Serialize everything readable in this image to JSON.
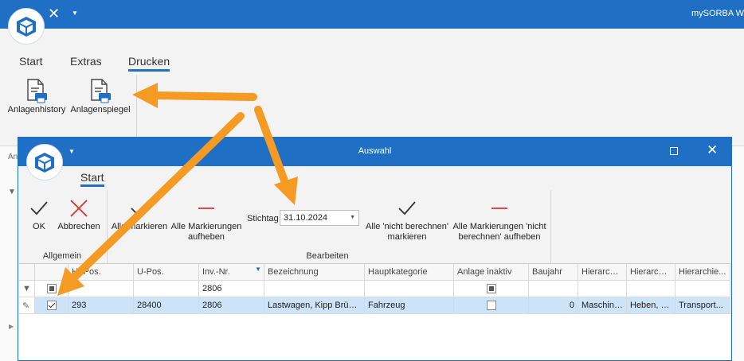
{
  "main": {
    "app_title": "mySORBA Wo",
    "tabs": [
      {
        "label": "Start"
      },
      {
        "label": "Extras"
      },
      {
        "label": "Drucken"
      }
    ],
    "buttons": [
      {
        "label": "Anlagenhistory"
      },
      {
        "label": "Anlagenspiegel"
      }
    ],
    "left_fragment": "An"
  },
  "dialog": {
    "title": "Auswahl",
    "tab": "Start",
    "buttons": {
      "ok": "OK",
      "abbrechen": "Abbrechen",
      "alle_markieren": "Alle markieren",
      "alle_markierungen_aufheben": "Alle Markierungen aufheben",
      "nicht_berechnen_markieren": "Alle 'nicht berechnen' markieren",
      "nicht_berechnen_aufheben": "Alle Markierungen 'nicht berechnen' aufheben"
    },
    "groups": {
      "allgemein": "Allgemein",
      "bearbeiten": "Bearbeiten"
    },
    "stichtag": {
      "label": "Stichtag",
      "value": "31.10.2024"
    },
    "grid": {
      "headers": [
        "H.-Pos.",
        "U-Pos.",
        "Inv.-Nr.",
        "Bezeichnung",
        "Hauptkategorie",
        "Anlage inaktiv",
        "Baujahr",
        "Hierarchi...",
        "Hierarchi...",
        "Hierarchie..."
      ],
      "filter_row": {
        "inv_nr": "2806"
      },
      "rows": [
        {
          "h_pos": "293",
          "u_pos": "28400",
          "inv_nr": "2806",
          "bezeichnung": "Lastwagen, Kipp Brück...",
          "hauptkategorie": "Fahrzeug",
          "baujahr": "0",
          "h1": "Maschine...",
          "h2": "Heben, F...",
          "h3": "Transport..."
        }
      ]
    }
  },
  "colors": {
    "accent": "#1f6fc5",
    "annotation_arrow": "#f59a23",
    "cancel_red": "#e0302a",
    "selected_row": "#cde3f7"
  }
}
